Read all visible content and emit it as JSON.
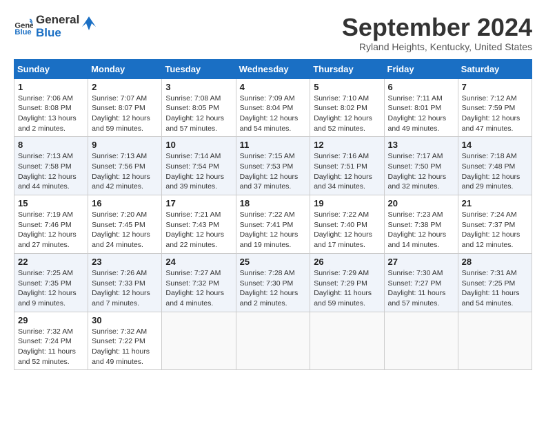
{
  "header": {
    "logo_line1": "General",
    "logo_line2": "Blue",
    "month": "September 2024",
    "location": "Ryland Heights, Kentucky, United States"
  },
  "weekdays": [
    "Sunday",
    "Monday",
    "Tuesday",
    "Wednesday",
    "Thursday",
    "Friday",
    "Saturday"
  ],
  "weeks": [
    [
      {
        "day": "1",
        "info": "Sunrise: 7:06 AM\nSunset: 8:08 PM\nDaylight: 13 hours\nand 2 minutes."
      },
      {
        "day": "2",
        "info": "Sunrise: 7:07 AM\nSunset: 8:07 PM\nDaylight: 12 hours\nand 59 minutes."
      },
      {
        "day": "3",
        "info": "Sunrise: 7:08 AM\nSunset: 8:05 PM\nDaylight: 12 hours\nand 57 minutes."
      },
      {
        "day": "4",
        "info": "Sunrise: 7:09 AM\nSunset: 8:04 PM\nDaylight: 12 hours\nand 54 minutes."
      },
      {
        "day": "5",
        "info": "Sunrise: 7:10 AM\nSunset: 8:02 PM\nDaylight: 12 hours\nand 52 minutes."
      },
      {
        "day": "6",
        "info": "Sunrise: 7:11 AM\nSunset: 8:01 PM\nDaylight: 12 hours\nand 49 minutes."
      },
      {
        "day": "7",
        "info": "Sunrise: 7:12 AM\nSunset: 7:59 PM\nDaylight: 12 hours\nand 47 minutes."
      }
    ],
    [
      {
        "day": "8",
        "info": "Sunrise: 7:13 AM\nSunset: 7:58 PM\nDaylight: 12 hours\nand 44 minutes."
      },
      {
        "day": "9",
        "info": "Sunrise: 7:13 AM\nSunset: 7:56 PM\nDaylight: 12 hours\nand 42 minutes."
      },
      {
        "day": "10",
        "info": "Sunrise: 7:14 AM\nSunset: 7:54 PM\nDaylight: 12 hours\nand 39 minutes."
      },
      {
        "day": "11",
        "info": "Sunrise: 7:15 AM\nSunset: 7:53 PM\nDaylight: 12 hours\nand 37 minutes."
      },
      {
        "day": "12",
        "info": "Sunrise: 7:16 AM\nSunset: 7:51 PM\nDaylight: 12 hours\nand 34 minutes."
      },
      {
        "day": "13",
        "info": "Sunrise: 7:17 AM\nSunset: 7:50 PM\nDaylight: 12 hours\nand 32 minutes."
      },
      {
        "day": "14",
        "info": "Sunrise: 7:18 AM\nSunset: 7:48 PM\nDaylight: 12 hours\nand 29 minutes."
      }
    ],
    [
      {
        "day": "15",
        "info": "Sunrise: 7:19 AM\nSunset: 7:46 PM\nDaylight: 12 hours\nand 27 minutes."
      },
      {
        "day": "16",
        "info": "Sunrise: 7:20 AM\nSunset: 7:45 PM\nDaylight: 12 hours\nand 24 minutes."
      },
      {
        "day": "17",
        "info": "Sunrise: 7:21 AM\nSunset: 7:43 PM\nDaylight: 12 hours\nand 22 minutes."
      },
      {
        "day": "18",
        "info": "Sunrise: 7:22 AM\nSunset: 7:41 PM\nDaylight: 12 hours\nand 19 minutes."
      },
      {
        "day": "19",
        "info": "Sunrise: 7:22 AM\nSunset: 7:40 PM\nDaylight: 12 hours\nand 17 minutes."
      },
      {
        "day": "20",
        "info": "Sunrise: 7:23 AM\nSunset: 7:38 PM\nDaylight: 12 hours\nand 14 minutes."
      },
      {
        "day": "21",
        "info": "Sunrise: 7:24 AM\nSunset: 7:37 PM\nDaylight: 12 hours\nand 12 minutes."
      }
    ],
    [
      {
        "day": "22",
        "info": "Sunrise: 7:25 AM\nSunset: 7:35 PM\nDaylight: 12 hours\nand 9 minutes."
      },
      {
        "day": "23",
        "info": "Sunrise: 7:26 AM\nSunset: 7:33 PM\nDaylight: 12 hours\nand 7 minutes."
      },
      {
        "day": "24",
        "info": "Sunrise: 7:27 AM\nSunset: 7:32 PM\nDaylight: 12 hours\nand 4 minutes."
      },
      {
        "day": "25",
        "info": "Sunrise: 7:28 AM\nSunset: 7:30 PM\nDaylight: 12 hours\nand 2 minutes."
      },
      {
        "day": "26",
        "info": "Sunrise: 7:29 AM\nSunset: 7:29 PM\nDaylight: 11 hours\nand 59 minutes."
      },
      {
        "day": "27",
        "info": "Sunrise: 7:30 AM\nSunset: 7:27 PM\nDaylight: 11 hours\nand 57 minutes."
      },
      {
        "day": "28",
        "info": "Sunrise: 7:31 AM\nSunset: 7:25 PM\nDaylight: 11 hours\nand 54 minutes."
      }
    ],
    [
      {
        "day": "29",
        "info": "Sunrise: 7:32 AM\nSunset: 7:24 PM\nDaylight: 11 hours\nand 52 minutes."
      },
      {
        "day": "30",
        "info": "Sunrise: 7:32 AM\nSunset: 7:22 PM\nDaylight: 11 hours\nand 49 minutes."
      },
      {
        "day": "",
        "info": ""
      },
      {
        "day": "",
        "info": ""
      },
      {
        "day": "",
        "info": ""
      },
      {
        "day": "",
        "info": ""
      },
      {
        "day": "",
        "info": ""
      }
    ]
  ]
}
